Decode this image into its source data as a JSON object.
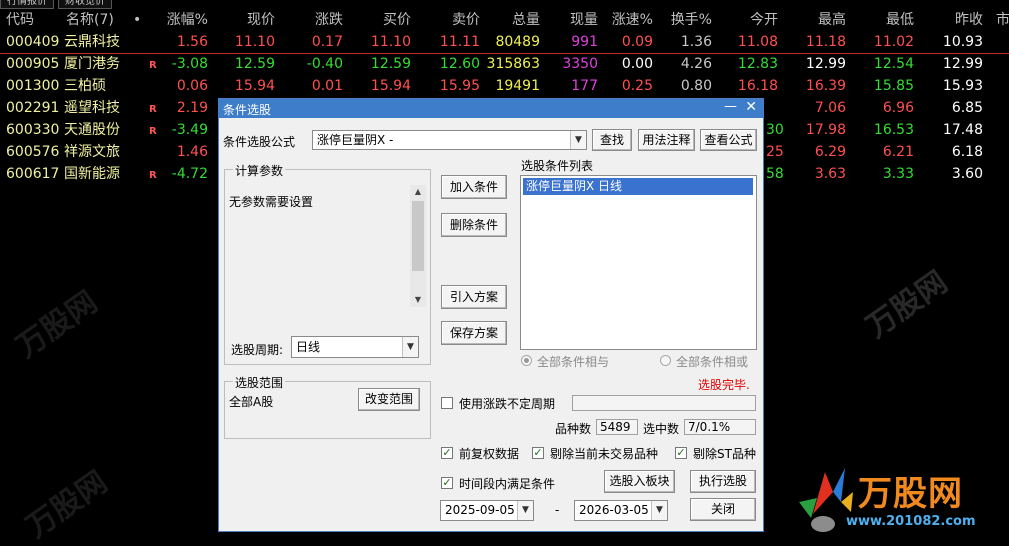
{
  "tabs": [
    "行情报价",
    "财收览价"
  ],
  "table": {
    "headers": {
      "code": "代码",
      "name": "名称(7)",
      "dot": "•",
      "change_pct": "涨幅%",
      "price": "现价",
      "change": "涨跌",
      "bid": "买价",
      "ask": "卖价",
      "volume": "总量",
      "cur_vol": "现量",
      "speed": "涨速%",
      "turnover": "换手%",
      "open": "今开",
      "high": "最高",
      "low": "最低",
      "prev_close": "昨收",
      "extra": "市"
    },
    "rows": [
      {
        "code": "000409",
        "name": "云鼎科技",
        "flag": "",
        "change_pct": "1.56",
        "price": "11.10",
        "change": "0.17",
        "bid": "11.10",
        "ask": "11.11",
        "volume": "80489",
        "cur_vol": "991",
        "speed": "0.09",
        "turnover": "1.36",
        "open": "11.08",
        "high": "11.18",
        "low": "11.02",
        "prev_close": "10.93"
      },
      {
        "code": "000905",
        "name": "厦门港务",
        "flag": "R",
        "change_pct": "-3.08",
        "price": "12.59",
        "change": "-0.40",
        "bid": "12.59",
        "ask": "12.60",
        "volume": "315863",
        "cur_vol": "3350",
        "speed": "0.00",
        "turnover": "4.26",
        "open": "12.83",
        "high": "12.99",
        "low": "12.54",
        "prev_close": "12.99"
      },
      {
        "code": "001300",
        "name": "三柏硕",
        "flag": "",
        "change_pct": "0.06",
        "price": "15.94",
        "change": "0.01",
        "bid": "15.94",
        "ask": "15.95",
        "volume": "19491",
        "cur_vol": "177",
        "speed": "0.25",
        "turnover": "0.80",
        "open": "16.18",
        "high": "16.39",
        "low": "15.85",
        "prev_close": "15.93"
      },
      {
        "code": "002291",
        "name": "遥望科技",
        "flag": "R",
        "change_pct": "2.19",
        "high": "7.06",
        "low": "6.96",
        "prev_close": "6.85"
      },
      {
        "code": "600330",
        "name": "天通股份",
        "flag": "R",
        "change_pct": "-3.49",
        "open_tail": "30",
        "high": "17.98",
        "low": "16.53",
        "prev_close": "17.48"
      },
      {
        "code": "600576",
        "name": "祥源文旅",
        "flag": "",
        "change_pct": "1.46",
        "open_tail": "25",
        "high": "6.29",
        "low": "6.21",
        "prev_close": "6.18"
      },
      {
        "code": "600617",
        "name": "国新能源",
        "flag": "R",
        "change_pct": "-4.72",
        "open_tail": "58",
        "high": "3.63",
        "low": "3.33",
        "prev_close": "3.60"
      }
    ]
  },
  "dialog": {
    "title": "条件选股",
    "minimize": "—",
    "close": "✕",
    "formula_label": "条件选股公式",
    "formula_value": "涨停巨量阴X  -",
    "find_btn": "查找",
    "usage_btn": "用法注释",
    "view_btn": "查看公式",
    "params_title": "计算参数",
    "params_text": "无参数需要设置",
    "period_label": "选股周期:",
    "period_value": "日线",
    "add_btn": "加入条件",
    "delete_btn": "删除条件",
    "import_btn": "引入方案",
    "save_btn": "保存方案",
    "cond_list_label": "选股条件列表",
    "cond_items": [
      "涨停巨量阴X  日线"
    ],
    "radio_and": "全部条件相与",
    "radio_or": "全部条件相或",
    "status": "选股完毕.",
    "range_title": "选股范围",
    "range_value": "全部A股",
    "change_range_btn": "改变范围",
    "use_period_label": "使用涨跌不定周期",
    "count_label": "品种数",
    "count_value": "5489",
    "selected_label": "选中数",
    "selected_value": "7/0.1%",
    "opt_fq": "前复权数据",
    "opt_untraded": "剔除当前未交易品种",
    "opt_st": "剔除ST品种",
    "opt_timerange": "时间段内满足条件",
    "to_block_btn": "选股入板块",
    "exec_btn": "执行选股",
    "date_from": "2025-09-05",
    "date_sep": "-",
    "date_to": "2026-03-05",
    "close_btn": "关闭"
  },
  "watermark": {
    "brand": "万股网",
    "url": "www.201082.com",
    "ghost": "万股网"
  }
}
